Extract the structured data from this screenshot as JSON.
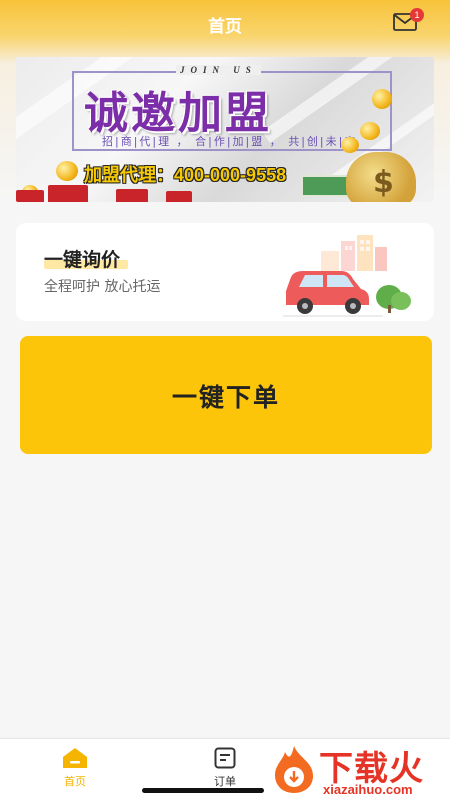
{
  "header": {
    "title": "首页",
    "mail_badge": "1"
  },
  "banner": {
    "join_text": "JOIN US",
    "title": "诚邀加盟",
    "subtitle": "招|商|代|理 ， 合|作|加|盟 ， 共|创|未|来",
    "phone": "加盟代理：400-000-9558",
    "money_sign": "$"
  },
  "inquiry_card": {
    "title": "一键询价",
    "subtitle": "全程呵护 放心托运"
  },
  "order_button": {
    "label": "一键下单"
  },
  "tabbar": {
    "items": [
      {
        "label": "首页",
        "active": true,
        "icon": "home-icon"
      },
      {
        "label": "订单",
        "active": false,
        "icon": "order-list-icon"
      }
    ],
    "active_color": "#f4b400",
    "inactive_color": "#333333"
  },
  "watermark": {
    "text": "下载火",
    "url": "xiazaihuo.com"
  },
  "colors": {
    "accent": "#fcc509",
    "badge": "#e53935"
  }
}
